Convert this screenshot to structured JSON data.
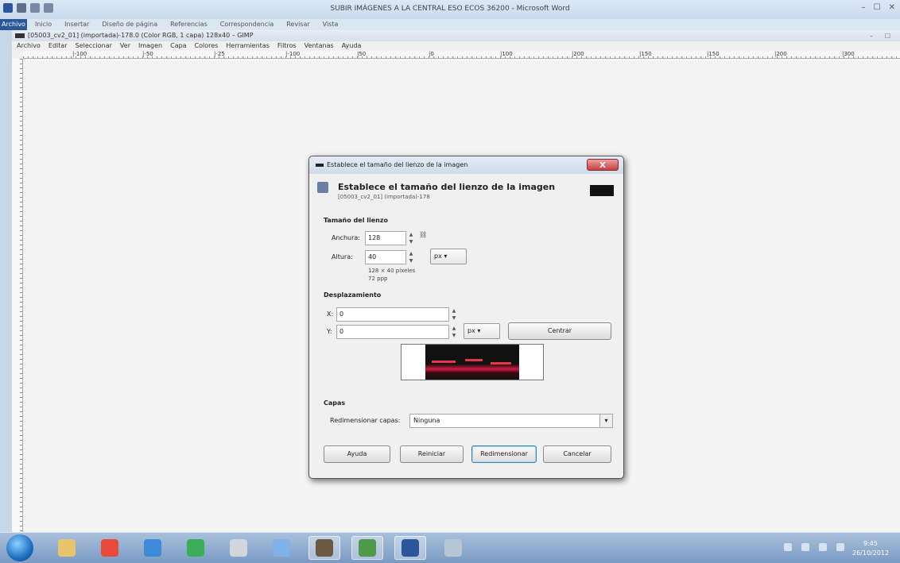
{
  "word": {
    "title": "SUBIR IMÁGENES A LA CENTRAL ESO ECOS 36200 - Microsoft Word",
    "tab_file": "Archivo",
    "tabs": [
      "Inicio",
      "Insertar",
      "Diseño de página",
      "Referencias",
      "Correspondencia",
      "Revisar",
      "Vista"
    ]
  },
  "gimp": {
    "title": "[05003_cv2_01] (importada)-178.0 (Color RGB, 1 capa) 128x40 – GIMP",
    "menu": [
      "Archivo",
      "Editar",
      "Seleccionar",
      "Ver",
      "Imagen",
      "Capa",
      "Colores",
      "Herramientas",
      "Filtros",
      "Ventanas",
      "Ayuda"
    ],
    "ruler_labels": [
      "|-100",
      "|-50",
      "|-25",
      "|-100",
      "|50",
      "|0",
      "|100",
      "|200",
      "|150",
      "|150",
      "|200",
      "|300"
    ]
  },
  "dialog": {
    "title": "Establece el tamaño del lienzo de la imagen",
    "header_title": "Establece el tamaño del lienzo de la imagen",
    "header_sub": "[05003_cv2_01] (importada)-178",
    "canvas_size": {
      "section": "Tamaño del lienzo",
      "width_label": "Anchura:",
      "width_value": "128",
      "height_label": "Altura:",
      "height_value": "40",
      "unit": "px",
      "info_pixels": "128 × 40 píxeles",
      "info_ppp": "72 ppp"
    },
    "offset": {
      "section": "Desplazamiento",
      "x_label": "X:",
      "x_value": "0",
      "y_label": "Y:",
      "y_value": "0",
      "unit": "px",
      "center_button": "Centrar"
    },
    "layers": {
      "section": "Capas",
      "resize_label": "Redimensionar capas:",
      "resize_value": "Ninguna"
    },
    "buttons": {
      "help": "Ayuda",
      "reset": "Reiniciar",
      "resize": "Redimensionar",
      "cancel": "Cancelar"
    },
    "close_glyph": "X"
  },
  "taskbar": {
    "clock_time": "9:45",
    "clock_date": "26/10/2012",
    "items": [
      {
        "icon": "explorer-icon",
        "color": "#e8c46a"
      },
      {
        "icon": "chrome-icon",
        "color": "#e84a3c"
      },
      {
        "icon": "ie-icon",
        "color": "#3c8ad8"
      },
      {
        "icon": "drive-icon",
        "color": "#3cae5a"
      },
      {
        "icon": "calculator-icon",
        "color": "#d0d6dc"
      },
      {
        "icon": "itunes-icon",
        "color": "#7fb2e8"
      },
      {
        "icon": "gimp-icon",
        "color": "#6a5a44"
      },
      {
        "icon": "picture-icon",
        "color": "#4e9a4a"
      },
      {
        "icon": "word-icon",
        "color": "#2b579a"
      },
      {
        "icon": "paint-icon",
        "color": "#b8c6d4"
      }
    ]
  }
}
